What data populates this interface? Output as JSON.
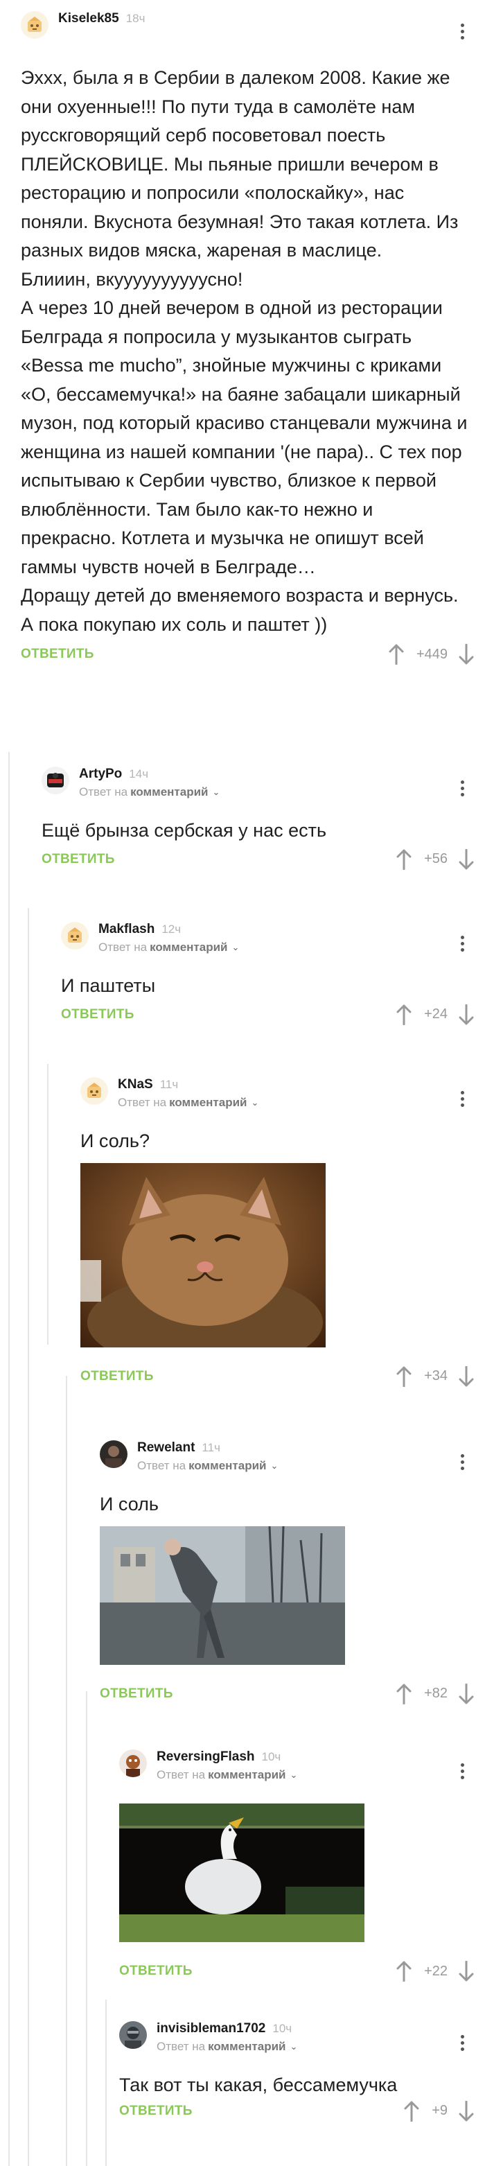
{
  "comments": [
    {
      "username": "Kiselek85",
      "time": "18ч",
      "text": "Эххх, была я в Сербии в далеком  2008. Какие же они охуенные!!! По пути туда в самолёте нам русскговорящий серб посоветовал поесть ПЛЕЙСКОВИЦЕ. Мы пьяные пришли вечером в ресторацию и попросили «полоскайку», нас поняли. Вкуснота безумная! Это такая котлета. Из разных видов мяска, жареная в маслице.\nБлииин, вкуууууууууусно!\nА через 10 дней вечером в одной из ресторации Белграда я попросила у музыкантов сыграть «Bessa me mucho”, знойные мужчины с криками «О, бессамемучка!» на баяне забацали шикарный музон, под который красиво станцевали мужчина и женщина из нашей компании '(не пара).. С тех пор испытываю к Сербии чувство, близкое к первой влюблённости. Там было как-то нежно и прекрасно. Котлета и музычка не опишут всей гаммы чувств ночей в Белграде…\nДоращу детей до вменяемого возраста и вернусь. А пока покупаю их соль и паштет ))",
      "reply_label": "ОТВЕТИТЬ",
      "score": "+449"
    },
    {
      "username": "ArtyPo",
      "time": "14ч",
      "reply_prefix": "Ответ на",
      "reply_ref": "комментарий",
      "text": "Ещё брынза сербская у нас есть",
      "reply_label": "ОТВЕТИТЬ",
      "score": "+56"
    },
    {
      "username": "Makflash",
      "time": "12ч",
      "reply_prefix": "Ответ на",
      "reply_ref": "комментарий",
      "text": "И паштеты",
      "reply_label": "ОТВЕТИТЬ",
      "score": "+24"
    },
    {
      "username": "KNaS",
      "time": "11ч",
      "reply_prefix": "Ответ на",
      "reply_ref": "комментарий",
      "text": "И соль?",
      "reply_label": "ОТВЕТИТЬ",
      "score": "+34"
    },
    {
      "username": "Rewelant",
      "time": "11ч",
      "reply_prefix": "Ответ на",
      "reply_ref": "комментарий",
      "text": "И соль",
      "reply_label": "ОТВЕТИТЬ",
      "score": "+82"
    },
    {
      "username": "ReversingFlash",
      "time": "10ч",
      "reply_prefix": "Ответ на",
      "reply_ref": "комментарий",
      "text": "",
      "reply_label": "ОТВЕТИТЬ",
      "score": "+22"
    },
    {
      "username": "invisibleman1702",
      "time": "10ч",
      "reply_prefix": "Ответ на",
      "reply_ref": "комментарий",
      "text": "Так вот ты какая, бессамемучка",
      "reply_label": "ОТВЕТИТЬ",
      "score": "+9"
    }
  ],
  "colors": {
    "reply_green": "#8ac858",
    "score_gray": "#999999",
    "thread_line": "#e5e5e5"
  },
  "icons": {
    "up": "arrow-up-icon",
    "down": "arrow-down-icon",
    "menu": "kebab-menu-icon",
    "chevron": "chevron-down-icon"
  }
}
